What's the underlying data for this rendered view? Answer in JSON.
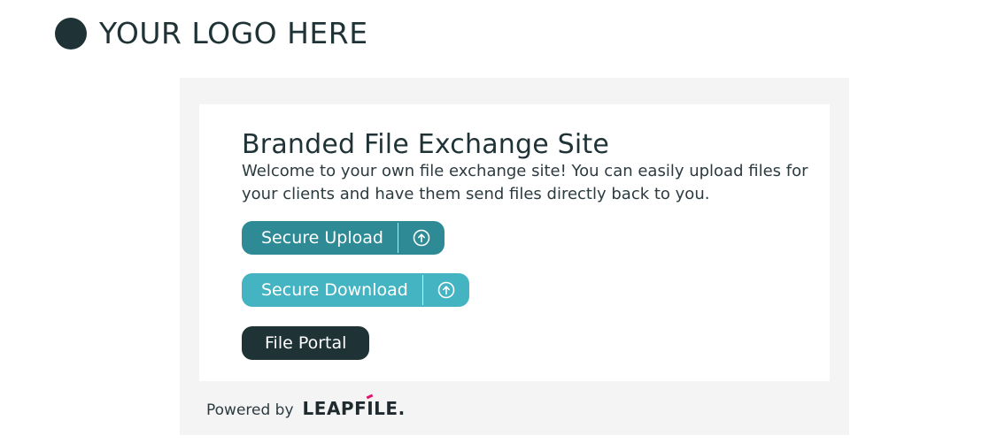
{
  "logo": {
    "text": "YOUR LOGO HERE"
  },
  "card": {
    "title": "Branded File Exchange Site",
    "welcome": "Welcome to your own file exchange site! You can easily upload files for your clients and have them send files directly back to you."
  },
  "buttons": {
    "upload_label": "Secure Upload",
    "upload_icon": "upload-circle-icon",
    "download_label": "Secure Download",
    "download_icon": "upload-circle-icon",
    "portal_label": "File Portal"
  },
  "footer": {
    "powered_by": "Powered by",
    "brand": "LEAPFILE."
  },
  "colors": {
    "upload": "#2e8a95",
    "download": "#44b4c2",
    "portal": "#1f3337",
    "panel_bg": "#f4f4f4",
    "leapfile_accent": "#e0156c"
  }
}
